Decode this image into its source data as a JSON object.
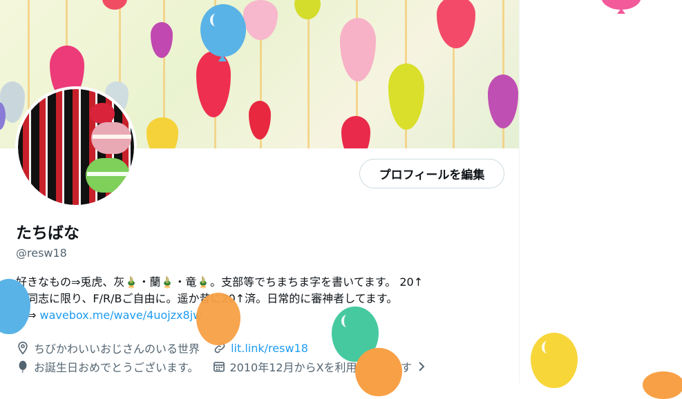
{
  "profile": {
    "display_name": "たちばな",
    "handle": "@resw18",
    "edit_button_label": "プロフィールを編集",
    "bio": {
      "line1": "好きなもの⇒兎虎、灰🎍・蘭🎍・竜🎍。支部等でちまちま字を書いてます。 20↑",
      "line2": "の同志に限り、F/R/Bご自由に。遥か昔に20↑済。日常的に審神者してます。",
      "line3_prefix": "箱⇒ ",
      "line3_link": "wavebox.me/wave/4uojzx8jw..."
    },
    "location": "ちびかわいいおじさんのいる世界",
    "website": "lit.link/resw18",
    "birthday": "お誕生日おめでとうございます。",
    "joined": "2010年12月からXを利用しています"
  },
  "icons": {
    "location": "location-pin-icon",
    "link": "link-icon",
    "birthday": "balloon-icon",
    "calendar": "calendar-icon",
    "chevron": "chevron-right-icon"
  },
  "colors": {
    "link": "#1d9bf0",
    "secondary_text": "#536471",
    "primary_text": "#0f1419"
  }
}
